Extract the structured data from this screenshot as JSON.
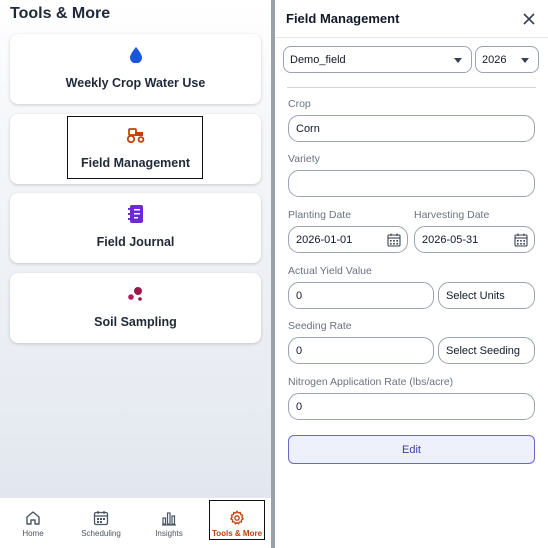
{
  "tools": {
    "title": "Tools & More",
    "cards": [
      {
        "label": "Weekly Crop Water Use",
        "icon": "water-drop-icon",
        "color": "#1a56db"
      },
      {
        "label": "Field Management",
        "icon": "tractor-icon",
        "color": "#c2410c"
      },
      {
        "label": "Field Journal",
        "icon": "notebook-icon",
        "color": "#6d28d9"
      },
      {
        "label": "Soil Sampling",
        "icon": "soil-dots-icon",
        "color": "#9d174d"
      }
    ]
  },
  "bottom_nav": [
    {
      "label": "Home",
      "icon": "home-icon"
    },
    {
      "label": "Scheduling",
      "icon": "calendar-icon"
    },
    {
      "label": "Insights",
      "icon": "bar-chart-icon"
    },
    {
      "label": "Tools & More",
      "icon": "gear-icon",
      "active": true
    }
  ],
  "panel": {
    "title": "Field Management",
    "field_select": "Demo_field",
    "year_select": "2026",
    "crop_label": "Crop",
    "crop_value": "Corn",
    "variety_label": "Variety",
    "variety_value": "",
    "planting_label": "Planting Date",
    "planting_value": "2026-01-01",
    "harvest_label": "Harvesting Date",
    "harvest_value": "2026-05-31",
    "yield_label": "Actual Yield Value",
    "yield_value": "0",
    "yield_units": "Select Units",
    "seeding_label": "Seeding Rate",
    "seeding_value": "0",
    "seeding_units": "Select Seeding",
    "nitrogen_label": "Nitrogen Application Rate (lbs/acre)",
    "nitrogen_value": "0",
    "edit_label": "Edit"
  },
  "colors": {
    "accent": "#c2410c",
    "button_border": "#6b67c9"
  }
}
